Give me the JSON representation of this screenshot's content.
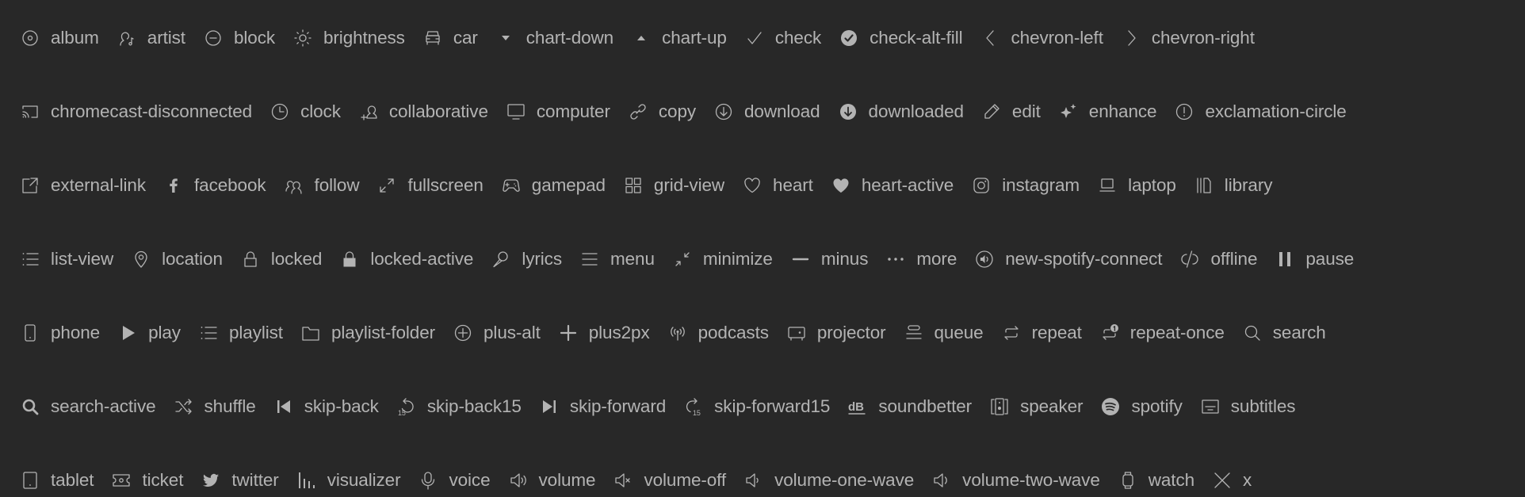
{
  "colors": {
    "background": "#282828",
    "text": "#b3b3b3"
  },
  "rows": [
    [
      {
        "icon": "album",
        "label": "album"
      },
      {
        "icon": "artist",
        "label": "artist"
      },
      {
        "icon": "block",
        "label": "block"
      },
      {
        "icon": "brightness",
        "label": "brightness"
      },
      {
        "icon": "car",
        "label": "car"
      },
      {
        "icon": "chart-down",
        "label": "chart-down"
      },
      {
        "icon": "chart-up",
        "label": "chart-up"
      },
      {
        "icon": "check",
        "label": "check"
      },
      {
        "icon": "check-alt-fill",
        "label": "check-alt-fill"
      },
      {
        "icon": "chevron-left",
        "label": "chevron-left"
      },
      {
        "icon": "chevron-right",
        "label": "chevron-right"
      }
    ],
    [
      {
        "icon": "chromecast-disconnected",
        "label": "chromecast-disconnected"
      },
      {
        "icon": "clock",
        "label": "clock"
      },
      {
        "icon": "collaborative",
        "label": "collaborative"
      },
      {
        "icon": "computer",
        "label": "computer"
      },
      {
        "icon": "copy",
        "label": "copy"
      },
      {
        "icon": "download",
        "label": "download"
      },
      {
        "icon": "downloaded",
        "label": "downloaded"
      },
      {
        "icon": "edit",
        "label": "edit"
      },
      {
        "icon": "enhance",
        "label": "enhance"
      },
      {
        "icon": "exclamation-circle",
        "label": "exclamation-circle"
      }
    ],
    [
      {
        "icon": "external-link",
        "label": "external-link"
      },
      {
        "icon": "facebook",
        "label": "facebook"
      },
      {
        "icon": "follow",
        "label": "follow"
      },
      {
        "icon": "fullscreen",
        "label": "fullscreen"
      },
      {
        "icon": "gamepad",
        "label": "gamepad"
      },
      {
        "icon": "grid-view",
        "label": "grid-view"
      },
      {
        "icon": "heart",
        "label": "heart"
      },
      {
        "icon": "heart-active",
        "label": "heart-active"
      },
      {
        "icon": "instagram",
        "label": "instagram"
      },
      {
        "icon": "laptop",
        "label": "laptop"
      },
      {
        "icon": "library",
        "label": "library"
      }
    ],
    [
      {
        "icon": "list-view",
        "label": "list-view"
      },
      {
        "icon": "location",
        "label": "location"
      },
      {
        "icon": "locked",
        "label": "locked"
      },
      {
        "icon": "locked-active",
        "label": "locked-active"
      },
      {
        "icon": "lyrics",
        "label": "lyrics"
      },
      {
        "icon": "menu",
        "label": "menu"
      },
      {
        "icon": "minimize",
        "label": "minimize"
      },
      {
        "icon": "minus",
        "label": "minus"
      },
      {
        "icon": "more",
        "label": "more"
      },
      {
        "icon": "new-spotify-connect",
        "label": "new-spotify-connect"
      },
      {
        "icon": "offline",
        "label": "offline"
      },
      {
        "icon": "pause",
        "label": "pause"
      }
    ],
    [
      {
        "icon": "phone",
        "label": "phone"
      },
      {
        "icon": "play",
        "label": "play"
      },
      {
        "icon": "playlist",
        "label": "playlist"
      },
      {
        "icon": "playlist-folder",
        "label": "playlist-folder"
      },
      {
        "icon": "plus-alt",
        "label": "plus-alt"
      },
      {
        "icon": "plus2px",
        "label": "plus2px"
      },
      {
        "icon": "podcasts",
        "label": "podcasts"
      },
      {
        "icon": "projector",
        "label": "projector"
      },
      {
        "icon": "queue",
        "label": "queue"
      },
      {
        "icon": "repeat",
        "label": "repeat"
      },
      {
        "icon": "repeat-once",
        "label": "repeat-once"
      },
      {
        "icon": "search",
        "label": "search"
      }
    ],
    [
      {
        "icon": "search-active",
        "label": "search-active"
      },
      {
        "icon": "shuffle",
        "label": "shuffle"
      },
      {
        "icon": "skip-back",
        "label": "skip-back"
      },
      {
        "icon": "skip-back15",
        "label": "skip-back15"
      },
      {
        "icon": "skip-forward",
        "label": "skip-forward"
      },
      {
        "icon": "skip-forward15",
        "label": "skip-forward15"
      },
      {
        "icon": "soundbetter",
        "label": "soundbetter"
      },
      {
        "icon": "speaker",
        "label": "speaker"
      },
      {
        "icon": "spotify",
        "label": "spotify"
      },
      {
        "icon": "subtitles",
        "label": "subtitles"
      }
    ],
    [
      {
        "icon": "tablet",
        "label": "tablet"
      },
      {
        "icon": "ticket",
        "label": "ticket"
      },
      {
        "icon": "twitter",
        "label": "twitter"
      },
      {
        "icon": "visualizer",
        "label": "visualizer"
      },
      {
        "icon": "voice",
        "label": "voice"
      },
      {
        "icon": "volume",
        "label": "volume"
      },
      {
        "icon": "volume-off",
        "label": "volume-off"
      },
      {
        "icon": "volume-one-wave",
        "label": "volume-one-wave"
      },
      {
        "icon": "volume-two-wave",
        "label": "volume-two-wave"
      },
      {
        "icon": "watch",
        "label": "watch"
      },
      {
        "icon": "x",
        "label": "x"
      }
    ]
  ]
}
